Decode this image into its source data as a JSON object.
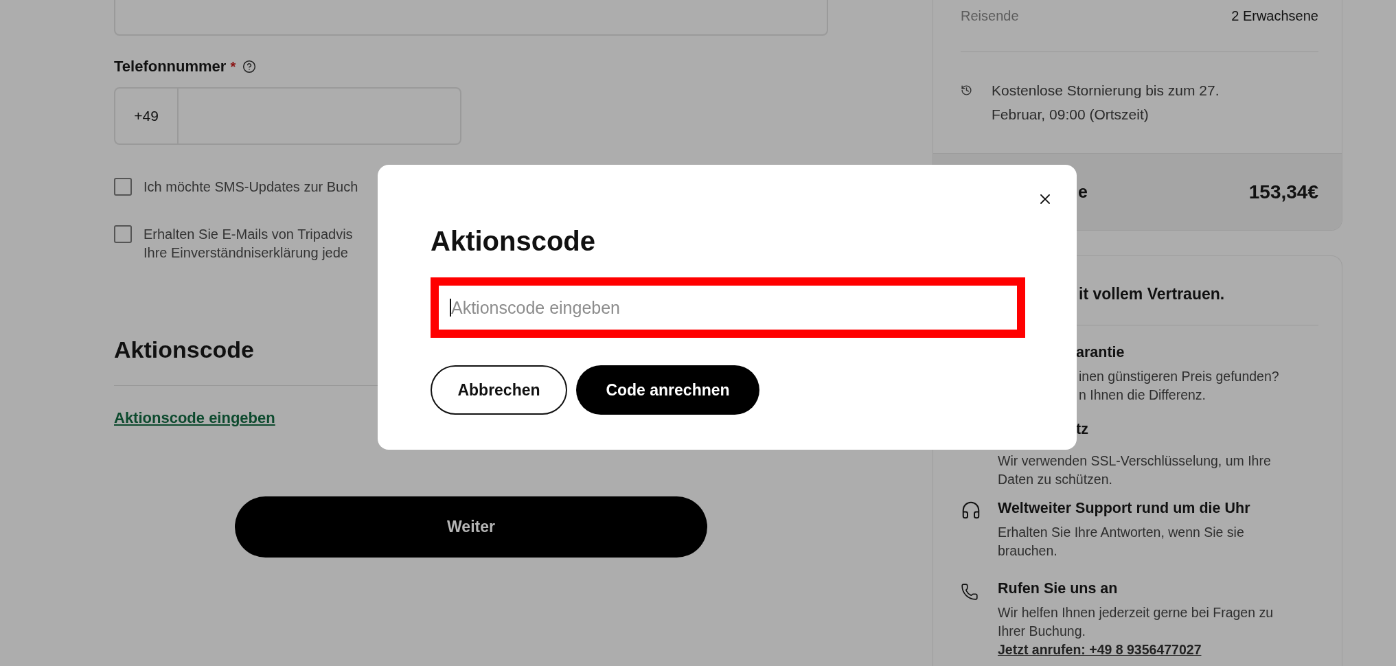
{
  "phone": {
    "label": "Telefonnummer",
    "required_mark": "*",
    "country_code": "+49"
  },
  "consents": [
    {
      "lines": [
        "Ich möchte SMS-Updates zur Buch"
      ],
      "checked": false
    },
    {
      "lines": [
        "Erhalten Sie E-Mails von Tripadvis",
        "Ihre Einverständniserklärung jede"
      ],
      "checked": false
    }
  ],
  "promo": {
    "heading": "Aktionscode",
    "link": "Aktionscode eingeben"
  },
  "continue_button": "Weiter",
  "summary": {
    "travelers_label": "Reisende",
    "travelers_value": "2 Erwachsene",
    "cancellation": [
      "Kostenlose Stornierung bis zum 27.",
      "Februar, 09:00 (Ortszeit)"
    ],
    "total": {
      "label": "e",
      "price": "153,34€"
    }
  },
  "trust": {
    "heading": "it vollem Vertrauen.",
    "features": [
      {
        "kind": "covered",
        "title": "arantie",
        "lines": [
          "inen günstigeren Preis gefunden?",
          "n Ihnen die Differenz."
        ]
      },
      {
        "kind": "partial",
        "title": "tz",
        "lines": [
          "Wir verwenden SSL-Verschlüsselung, um Ihre",
          "Daten zu schützen."
        ]
      },
      {
        "kind": "headset",
        "title": "Weltweiter Support rund um die Uhr",
        "lines": [
          "Erhalten Sie Ihre Antworten, wenn Sie sie",
          "brauchen."
        ]
      },
      {
        "kind": "phone",
        "title": "Rufen Sie uns an",
        "lines": [
          "Wir helfen Ihnen jederzeit gerne bei Fragen zu",
          "Ihrer Buchung."
        ],
        "link": "Jetzt anrufen: +49 8 9356477027"
      }
    ]
  },
  "dialog": {
    "title": "Aktionscode",
    "placeholder": "Aktionscode eingeben",
    "buttons": [
      {
        "kind": "secondary",
        "label": "Abbrechen"
      },
      {
        "kind": "primary",
        "label": "Code anrechnen"
      }
    ]
  }
}
